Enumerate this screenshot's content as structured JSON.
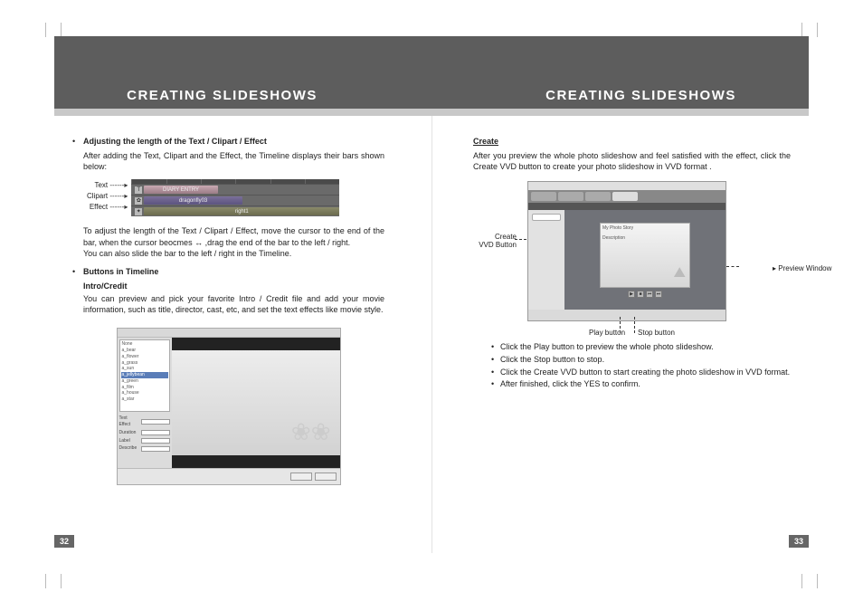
{
  "left": {
    "title": "CREATING SLIDESHOWS",
    "b1_heading": "Adjusting the length of the Text / Clipart / Effect",
    "b1_para": "After adding the Text, Clipart and the Effect, the Timeline displays their bars shown below:",
    "timeline": {
      "labels": {
        "text": "Text",
        "clipart": "Clipart",
        "effect": "Effect"
      },
      "bar1": "DIARY ENTRY",
      "bar2": "dragonfly03",
      "bar3": "right1"
    },
    "b1_para2a": "To adjust the length of the Text / Clipart / Effect, move the cursor to the end of the bar, when the cursor beocmes ",
    "b1_para2b": " ,drag the end of the bar to the left / right.",
    "b1_para3": "You can also slide the bar to the left / right in the Timeline.",
    "b2_heading": "Buttons in Timeline",
    "b2_sub": "Intro/Credit",
    "b2_para": "You can preview and pick your favorite Intro / Credit file and add your movie information, such as title, director, cast, etc, and set the text effects like movie style.",
    "pagenum": "32"
  },
  "right": {
    "title": "CREATING SLIDESHOWS",
    "create_heading": "Create",
    "create_para": "After you preview the whole photo slideshow and feel satisfied with the effect, click the Create VVD button to create your photo slideshow in VVD format .",
    "callout_create_l1": "Create",
    "callout_create_l2": "VVD Button",
    "callout_preview": "Preview Window",
    "preview_title": "My Photo Story",
    "preview_sub": "Description",
    "callout_play": "Play button",
    "callout_stop": "Stop button",
    "li1": "Click the Play button to preview the whole photo slideshow.",
    "li2": "Click the Stop button to stop.",
    "li3": "Click the Create VVD button to start creating the photo slideshow in VVD format.",
    "li4": "After finished, click the YES to confirm.",
    "pagenum": "33"
  }
}
